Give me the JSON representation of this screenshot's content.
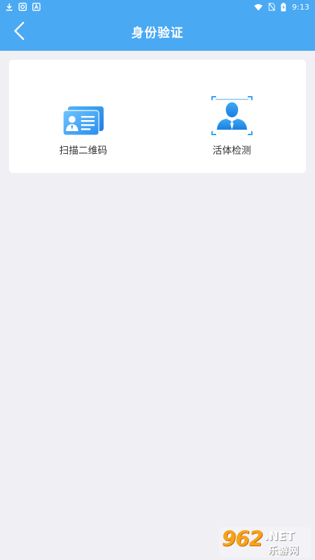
{
  "status_bar": {
    "time": "9:13",
    "left_icons": [
      "download-icon",
      "app-badge-icon",
      "a-badge-icon"
    ],
    "right_icons": [
      "wifi-icon",
      "no-sim-icon",
      "battery-icon"
    ]
  },
  "nav": {
    "title": "身份验证",
    "back_icon": "chevron-left-icon"
  },
  "options": [
    {
      "label": "扫描二维码",
      "icon": "id-card-icon"
    },
    {
      "label": "活体检测",
      "icon": "face-scan-icon"
    }
  ],
  "watermark": {
    "number": "962",
    "suffix": ".NET",
    "chinese": "乐游网"
  },
  "colors": {
    "primary": "#4aa9f3",
    "background": "#efeff4",
    "card": "#ffffff",
    "text": "#333333",
    "icon_blue": "#1e88e5"
  }
}
